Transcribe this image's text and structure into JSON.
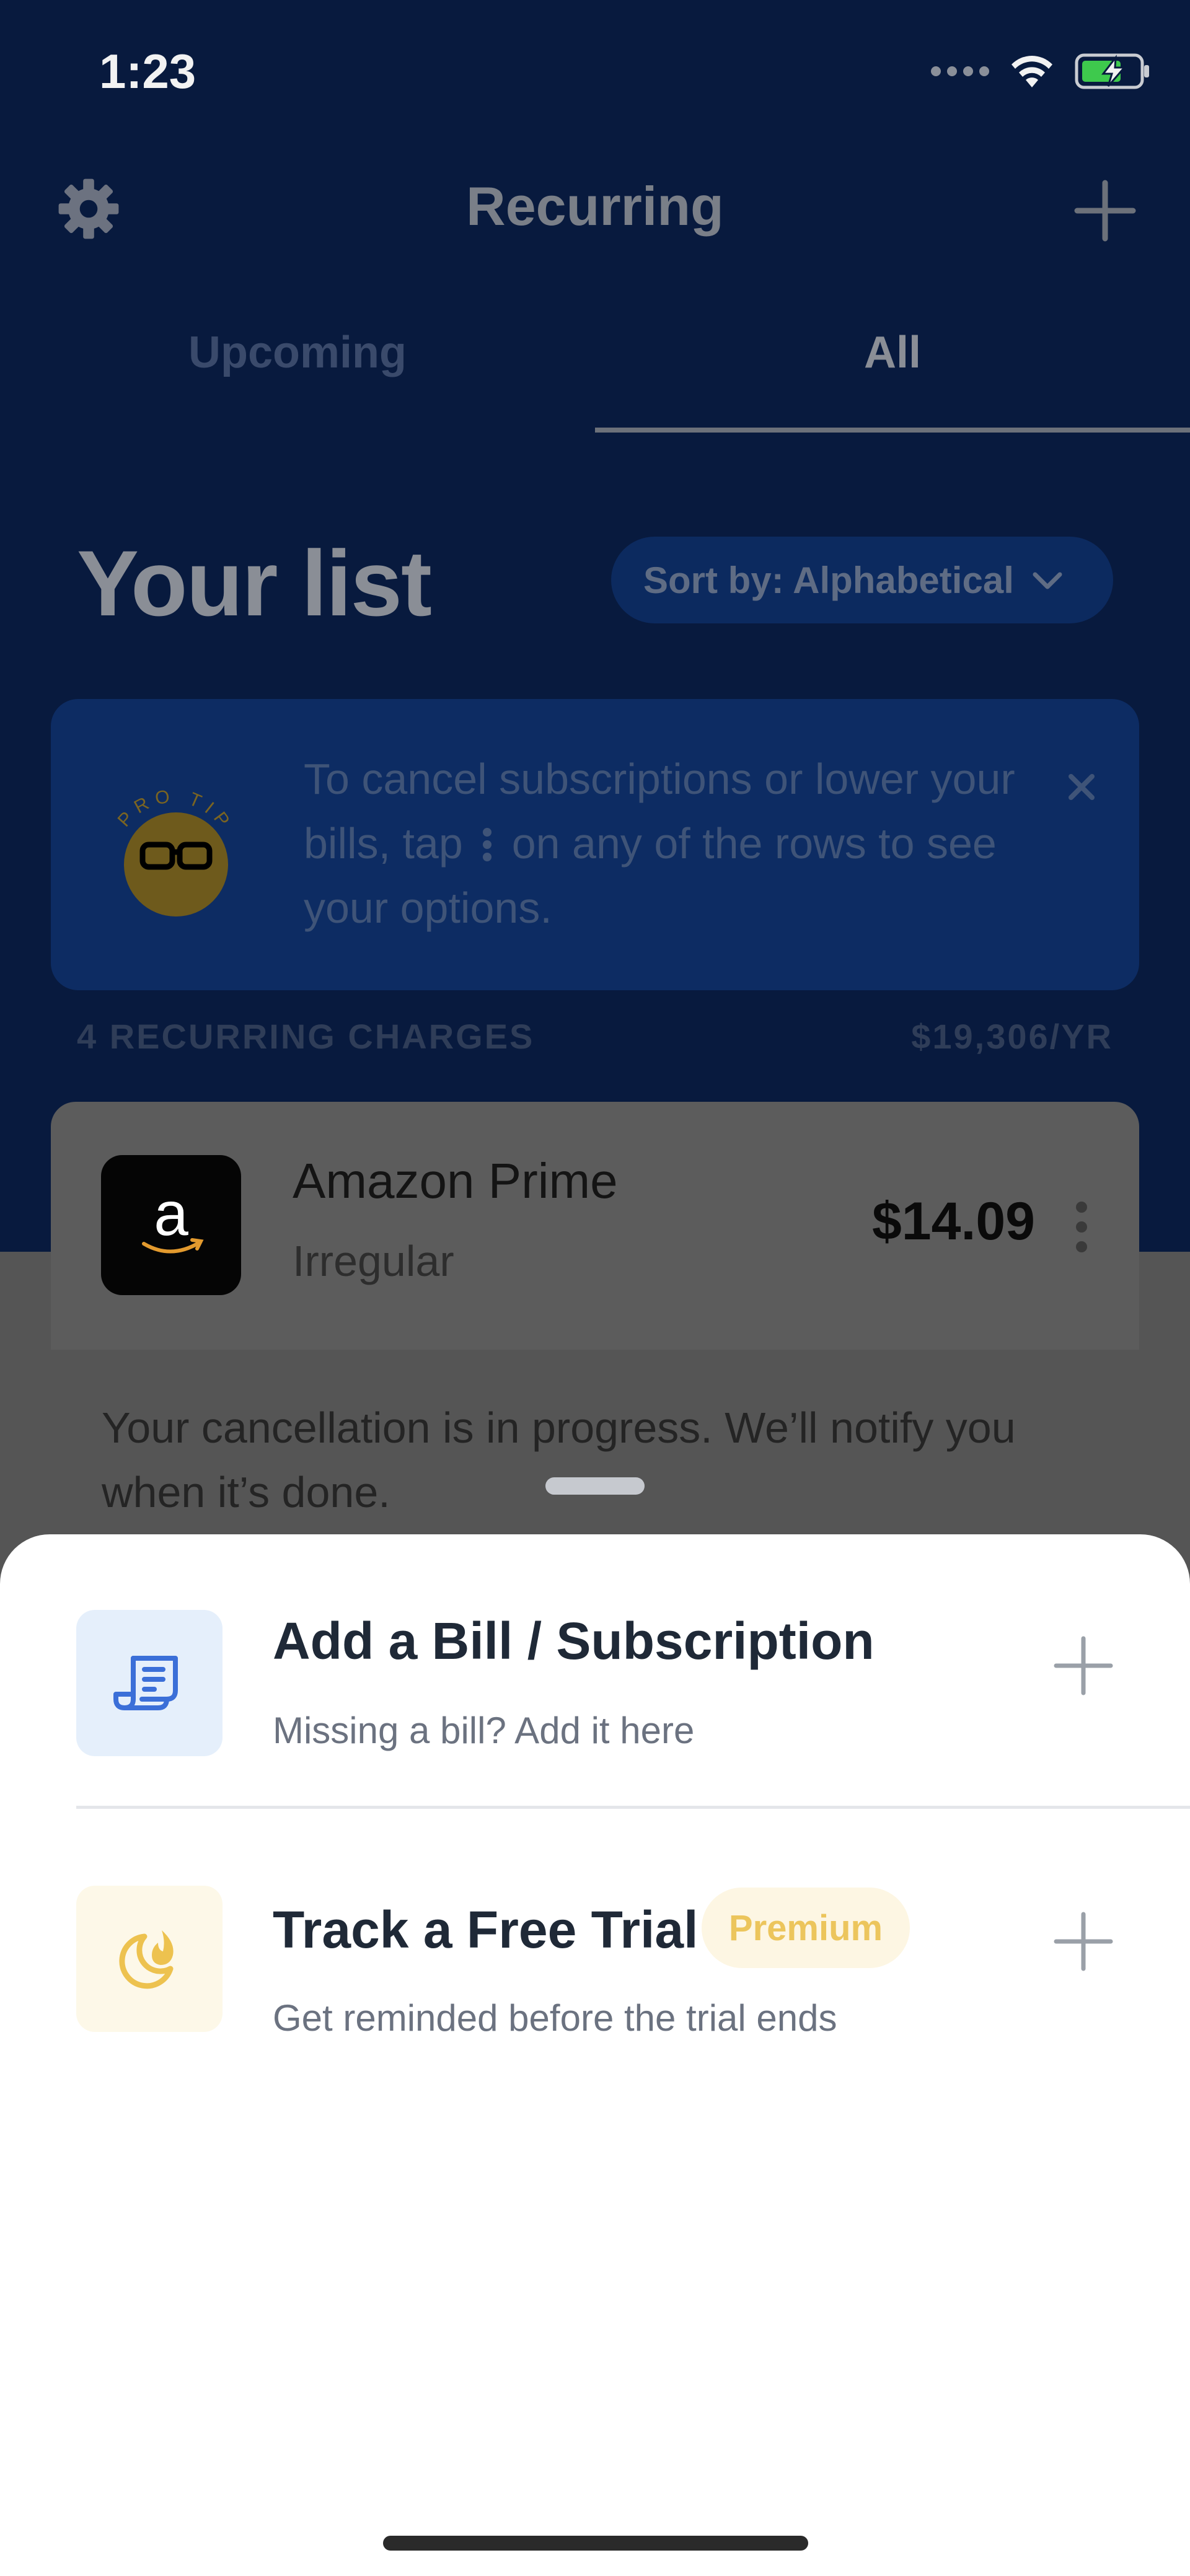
{
  "status_bar": {
    "time": "1:23"
  },
  "header": {
    "title": "Recurring"
  },
  "tabs": [
    {
      "label": "Upcoming",
      "active": false
    },
    {
      "label": "All",
      "active": true
    }
  ],
  "list": {
    "title": "Your list",
    "sort_label": "Sort by: Alphabetical"
  },
  "pro_tip": {
    "badge_text": "PRO TIP",
    "text_before": "To cancel subscriptions or lower your bills, tap",
    "text_after": "on any of the rows to see your options."
  },
  "summary": {
    "count_label": "4 RECURRING CHARGES",
    "total_label": "$19,306/YR"
  },
  "charge": {
    "logo_letter": "a",
    "name": "Amazon Prime",
    "frequency": "Irregular",
    "amount": "$14.09",
    "status_message": "Your cancellation is in progress. We’ll notify you when it’s done."
  },
  "sheet": {
    "options": [
      {
        "title": "Add a Bill / Subscription",
        "subtitle": "Missing a bill? Add it here",
        "icon": "receipt-icon"
      },
      {
        "title": "Track a Free Trial",
        "subtitle": "Get reminded before the trial ends",
        "badge": "Premium",
        "icon": "moon-flame-icon"
      }
    ]
  },
  "colors": {
    "header_bg": "#081a3e",
    "sheet_bg": "#ffffff",
    "accent_blue": "#3b6fd8",
    "premium_gold": "#ecc55c"
  }
}
